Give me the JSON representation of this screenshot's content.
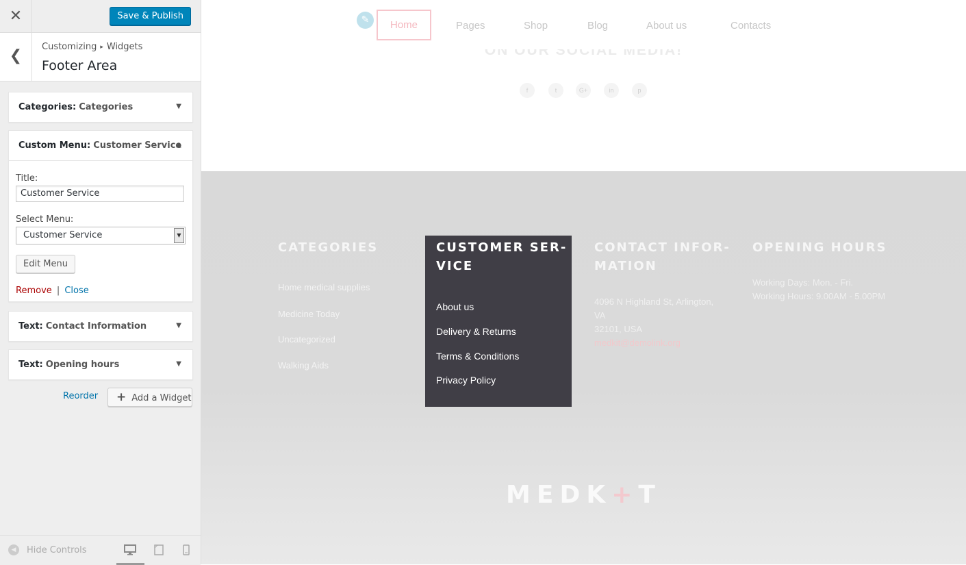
{
  "sidebar": {
    "close_glyph": "✕",
    "save_label": "Save & Publish",
    "back_glyph": "❮",
    "breadcrumb": [
      "Customizing",
      "Widgets"
    ],
    "breadcrumb_sep": "▸",
    "panel_title": "Footer Area",
    "widgets": [
      {
        "type": "Categories:",
        "name": "Categories",
        "expanded": false,
        "arrow": "▼"
      },
      {
        "type": "Custom Menu:",
        "name": "Customer Service",
        "expanded": true,
        "arrow": "▲"
      },
      {
        "type": "Text:",
        "name": "Contact Information",
        "expanded": false,
        "arrow": "▼"
      },
      {
        "type": "Text:",
        "name": "Opening hours",
        "expanded": false,
        "arrow": "▼"
      }
    ],
    "form": {
      "title_label": "Title:",
      "title_value": "Customer Service",
      "menu_label": "Select Menu:",
      "menu_value": "Customer Service",
      "edit_menu": "Edit Menu",
      "remove": "Remove",
      "divider": "|",
      "close": "Close"
    },
    "reorder": "Reorder",
    "add_widget": "Add a Widget",
    "add_plus": "+",
    "hide_controls": "Hide Controls",
    "devices": [
      "desktop-icon",
      "tablet-icon",
      "mobile-icon"
    ]
  },
  "preview": {
    "nav": [
      "Home",
      "Pages",
      "Shop",
      "Blog",
      "About us",
      "Contacts"
    ],
    "faded_heading": "ON OUR SOCIAL MEDIA!",
    "social": [
      "f",
      "t",
      "G+",
      "in",
      "p"
    ],
    "footer": {
      "categories": {
        "heading": "CATEGORIES",
        "links": [
          "Home medical supplies",
          "Medicine Today",
          "Uncategorized",
          "Walking Aids"
        ]
      },
      "customer_service": {
        "heading_line1": "CUSTOMER SER-",
        "heading_line2": "VICE",
        "links": [
          "About us",
          "Delivery & Returns",
          "Terms & Conditions",
          "Privacy Policy"
        ]
      },
      "contact": {
        "heading_line1": "CONTACT INFOR-",
        "heading_line2": "MATION",
        "address1": "4096 N Highland St, Arlington,",
        "address2": "VA",
        "address3": "32101, USA",
        "email": "medkit@demolink.org"
      },
      "hours": {
        "heading": "OPENING HOURS",
        "line1": "Working Days: Mon. - Fri.",
        "line2": "Working Hours: 9.00AM - 5.00PM"
      },
      "logo_left": "MEDK",
      "logo_cross": "+",
      "logo_right": "T"
    }
  },
  "colors": {
    "primary_button": "#0085ba",
    "link": "#0073aa",
    "remove": "#aa0000",
    "menu_box": "#403e46",
    "accent_pink": "#f4b7be"
  }
}
